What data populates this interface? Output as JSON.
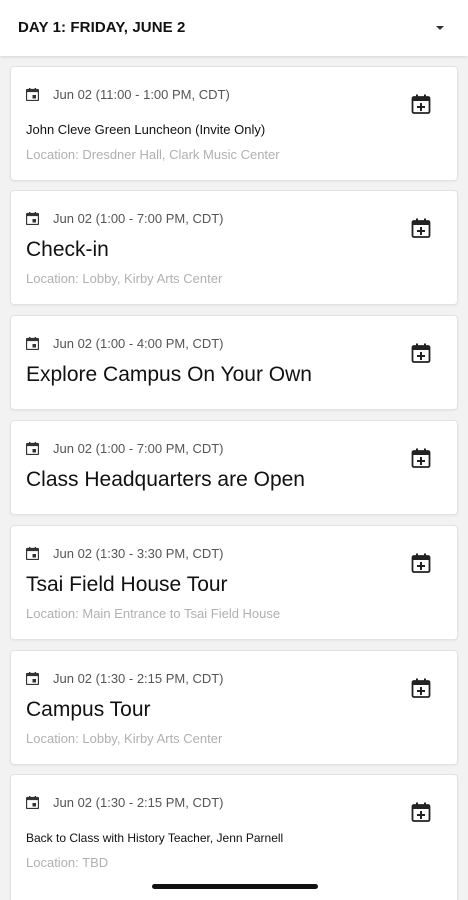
{
  "header": {
    "day_label": "DAY 1: FRIDAY, JUNE 2",
    "dropdown_icon": "caret-down-icon"
  },
  "icons": {
    "date": "calendar-icon",
    "add": "calendar-add-icon"
  },
  "colors": {
    "background": "#f2f2f2",
    "card": "#ffffff",
    "location_text": "#b0b0b0",
    "primary_text": "#111111"
  },
  "events": [
    {
      "date": "Jun 02 (11:00 - 1:00 PM, CDT)",
      "title": "John Cleve Green Luncheon (Invite Only)",
      "location": "Location: Dresdner Hall, Clark Music Center"
    },
    {
      "date": "Jun 02 (1:00 - 7:00 PM, CDT)",
      "title": "Check-in",
      "location": "Location: Lobby, Kirby Arts Center"
    },
    {
      "date": "Jun 02 (1:00 - 4:00 PM, CDT)",
      "title": "Explore Campus On Your Own"
    },
    {
      "date": "Jun 02 (1:00 - 7:00 PM, CDT)",
      "title": "Class Headquarters are Open"
    },
    {
      "date": "Jun 02 (1:30 - 3:30 PM, CDT)",
      "title": "Tsai Field House Tour",
      "location": "Location: Main Entrance to Tsai Field House"
    },
    {
      "date": "Jun 02 (1:30 - 2:15 PM, CDT)",
      "title": "Campus Tour",
      "location": "Location: Lobby, Kirby Arts Center"
    },
    {
      "date": "Jun 02 (1:30 - 2:15 PM, CDT)",
      "title": "Back to Class with History Teacher, Jenn Parnell",
      "location": "Location: TBD"
    }
  ]
}
